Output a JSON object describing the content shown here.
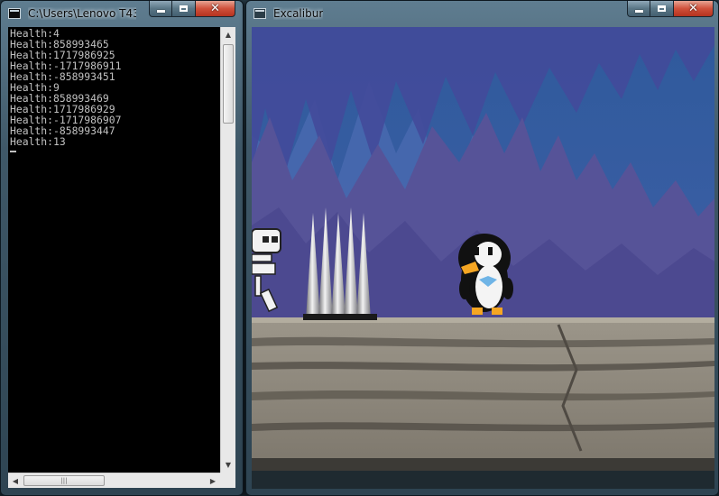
{
  "console_window": {
    "title": "C:\\Users\\Lenovo T430...",
    "lines": [
      "Health:4",
      "Health:858993465",
      "Health:1717986925",
      "Health:-1717986911",
      "Health:-858993451",
      "Health:9",
      "Health:858993469",
      "Health:1717986929",
      "Health:-1717986907",
      "Health:-858993447",
      "Health:13"
    ],
    "scroll_up_glyph": "▲",
    "scroll_down_glyph": "▼",
    "scroll_left_glyph": "◀",
    "scroll_right_glyph": "▶",
    "hthumb_grip": "|||"
  },
  "game_window": {
    "title": "Excalibur",
    "scene": {
      "characters": [
        "skeleton",
        "penguin"
      ],
      "obstacle": "spikes",
      "spike_count": 5
    }
  },
  "caption": {
    "close_glyph": "✕"
  },
  "colors": {
    "console_bg": "#000000",
    "console_text": "#c0c0c0",
    "sky": "#2d5b9e",
    "cave_wall": "#4e4a8a",
    "ground": "#8a8478",
    "close_button": "#c8452f"
  },
  "icons": [
    "console-window-icon",
    "game-window-icon",
    "minimize-icon",
    "maximize-icon",
    "close-icon"
  ]
}
